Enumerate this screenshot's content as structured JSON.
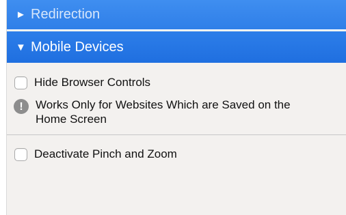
{
  "sections": {
    "redirection": {
      "arrow": "►",
      "label": "Redirection"
    },
    "mobile_devices": {
      "arrow": "▼",
      "label": "Mobile Devices"
    }
  },
  "options": {
    "hide_browser_controls": {
      "label": "Hide Browser Controls",
      "checked": false
    },
    "deactivate_pinch_zoom": {
      "label": "Deactivate Pinch and Zoom",
      "checked": false
    }
  },
  "info": {
    "icon": "exclamation-icon",
    "icon_glyph": "!",
    "line1": "Works Only for Websites Which are Saved on the",
    "line2": "Home Screen"
  }
}
